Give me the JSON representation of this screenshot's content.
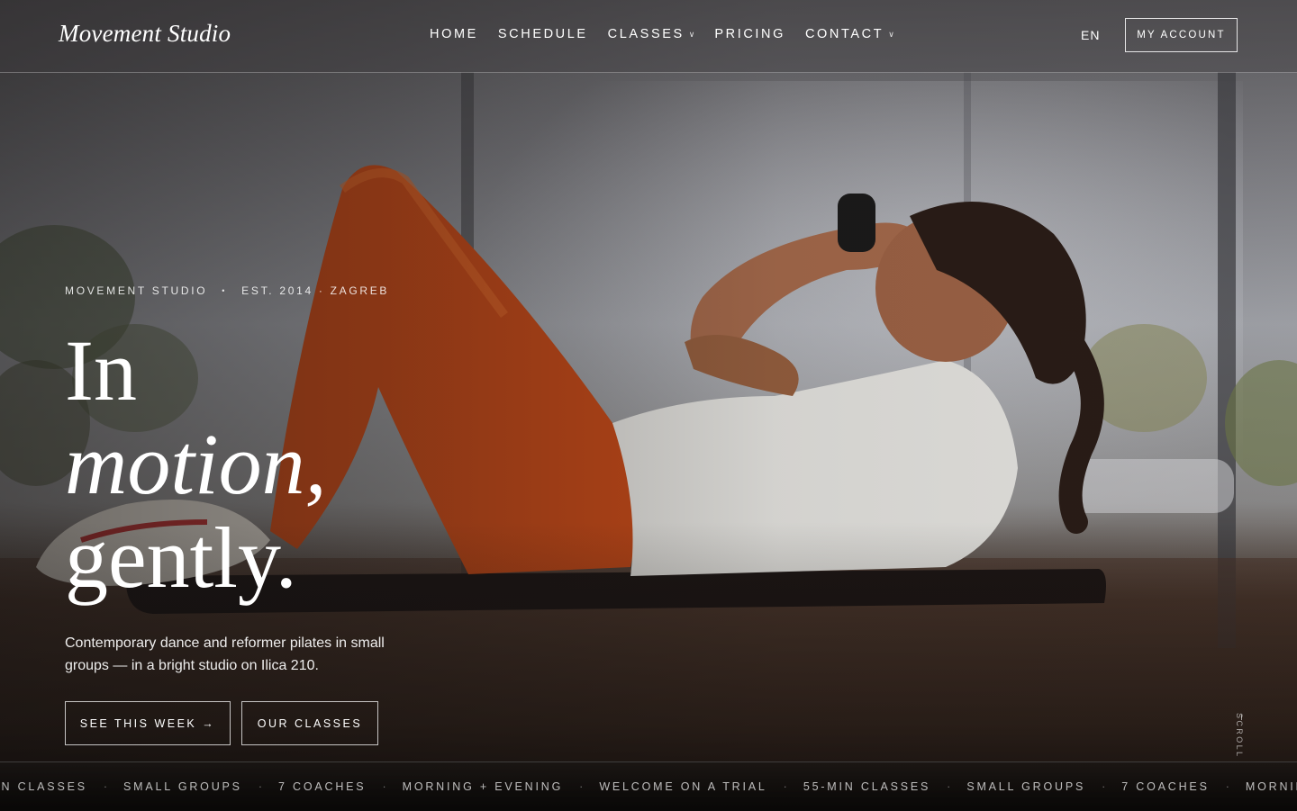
{
  "brand": {
    "logo": "Movement Studio"
  },
  "nav": {
    "items": [
      {
        "label": "HOME",
        "dropdown": false
      },
      {
        "label": "SCHEDULE",
        "dropdown": false
      },
      {
        "label": "CLASSES",
        "dropdown": true
      },
      {
        "label": "PRICING",
        "dropdown": false
      },
      {
        "label": "CONTACT",
        "dropdown": true
      }
    ],
    "language": "EN",
    "account_label": "MY ACCOUNT"
  },
  "hero": {
    "eyebrow_left": "MOVEMENT STUDIO",
    "eyebrow_separator": "•",
    "eyebrow_right": "EST. 2014 · ZAGREB",
    "headline_line1": "In",
    "headline_line2": "motion,",
    "headline_line3": "gently.",
    "lede": "Contemporary dance and reformer pilates in small groups — in a bright studio on Ilica 210.",
    "primary_cta": "SEE THIS WEEK →",
    "secondary_cta": "OUR CLASSES",
    "scroll_label": "SCROLL"
  },
  "marquee": {
    "items": [
      "MIN CLASSES",
      "SMALL GROUPS",
      "7 COACHES",
      "MORNING + EVENING",
      "WELCOME ON A TRIAL",
      "55-MIN CLASSES",
      "SMALL GROUPS",
      "7 COACHES",
      "MORNING"
    ],
    "separator": "·"
  },
  "colors": {
    "text": "#ffffff",
    "legging_orange": "#d2541c",
    "shirt_white": "#ecebe8",
    "floor_brown": "#4a3328"
  }
}
